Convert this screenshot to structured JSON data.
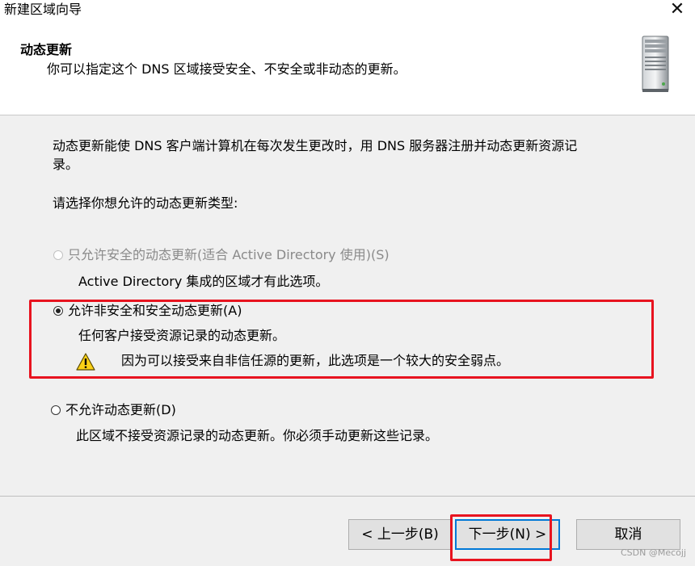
{
  "window": {
    "title": "新建区域向导",
    "close_icon": "close-icon"
  },
  "header": {
    "title": "动态更新",
    "subtitle": "你可以指定这个 DNS 区域接受安全、不安全或非动态的更新。",
    "icon": "server-icon"
  },
  "body": {
    "description_line1": "动态更新能使 DNS 客户端计算机在每次发生更改时，用 DNS 服务器注册并动态更新资源记",
    "description_line2": "录。",
    "prompt": "请选择你想允许的动态更新类型:",
    "options": [
      {
        "label": "只允许安全的动态更新(适合 Active Directory 使用)(S)",
        "description": "Active Directory 集成的区域才有此选项。",
        "enabled": false,
        "selected": false
      },
      {
        "label": "允许非安全和安全动态更新(A)",
        "description": "任何客户接受资源记录的动态更新。",
        "warning": "因为可以接受来自非信任源的更新，此选项是一个较大的安全弱点。",
        "enabled": true,
        "selected": true
      },
      {
        "label": "不允许动态更新(D)",
        "description": "此区域不接受资源记录的动态更新。你必须手动更新这些记录。",
        "enabled": true,
        "selected": false
      }
    ]
  },
  "footer": {
    "back_label": "< 上一步(B)",
    "next_label": "下一步(N) >",
    "cancel_label": "取消"
  },
  "watermark": "CSDN @Mecojj",
  "colors": {
    "highlight_red": "#e8131f",
    "focus_blue": "#0078d7",
    "panel_bg": "#f0f0f0"
  }
}
